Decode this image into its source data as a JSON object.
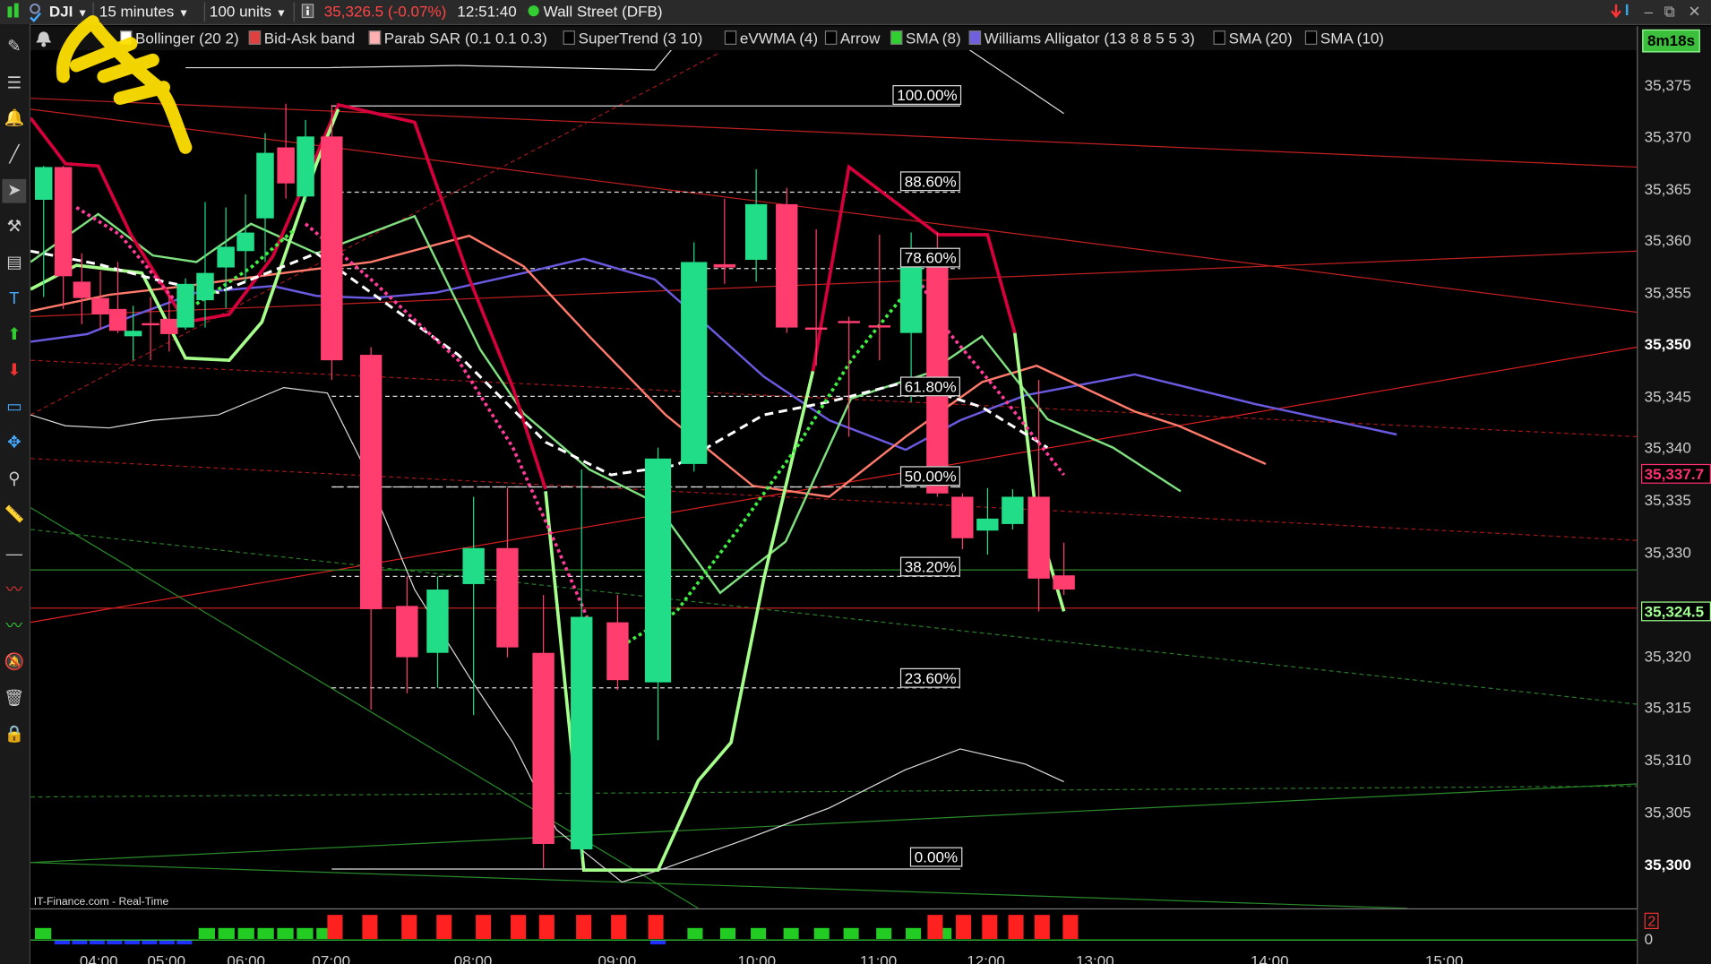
{
  "toolbar": {
    "symbol": "DJI",
    "timeframe": "15 minutes",
    "units": "100 units",
    "price_change": "35,326.5 (-0.07%)",
    "time": "12:51:40",
    "market": "Wall Street (DFB)"
  },
  "indicators": [
    {
      "label": "Bollinger (20 2)",
      "color": "#ffffff"
    },
    {
      "label": "Bid-Ask band",
      "color": "#e04040"
    },
    {
      "label": "Parab SAR (0.1 0.1 0.3)",
      "color": "#ffb0b0"
    },
    {
      "label": "SuperTrend (3 10)",
      "color": "#000000"
    },
    {
      "label": "eVWMA (4)",
      "color": "#000000"
    },
    {
      "label": "Arrow",
      "color": "#000000"
    },
    {
      "label": "SMA (8)",
      "color": "#30d030"
    },
    {
      "label": "Williams Alligator (13 8 8 5 5 3)",
      "color": "#7060e0"
    },
    {
      "label": "SMA (20)",
      "color": "#000000"
    },
    {
      "label": "SMA (10)",
      "color": "#000000"
    }
  ],
  "countdown": "8m18s",
  "price_axis": {
    "ticks": [
      "35,375",
      "35,370",
      "35,365",
      "35,360",
      "35,355",
      "35,350",
      "35,345",
      "35,340",
      "35,335",
      "35,330",
      "35,320",
      "35,315",
      "35,310",
      "35,305",
      "35,300"
    ],
    "bid_label": "35,337.7",
    "last_label": "35,324.5",
    "bid_color": "#ff3070",
    "last_color": "#a0ff90"
  },
  "fib_levels": [
    "100.00%",
    "88.60%",
    "78.60%",
    "61.80%",
    "50.00%",
    "38.20%",
    "23.60%",
    "0.00%"
  ],
  "footer": "IT-Finance.com - Real-Time",
  "lower_axis": {
    "top": "2",
    "bottom": "0"
  },
  "time_axis": [
    "04:00",
    "05:00",
    "06:00",
    "07:00",
    "08:00",
    "09:00",
    "10:00",
    "11:00",
    "12:00",
    "13:00",
    "14:00",
    "15:00"
  ],
  "colors": {
    "up": "#22dd88",
    "down": "#ff3d6e",
    "highlighter": "#ffe000"
  }
}
